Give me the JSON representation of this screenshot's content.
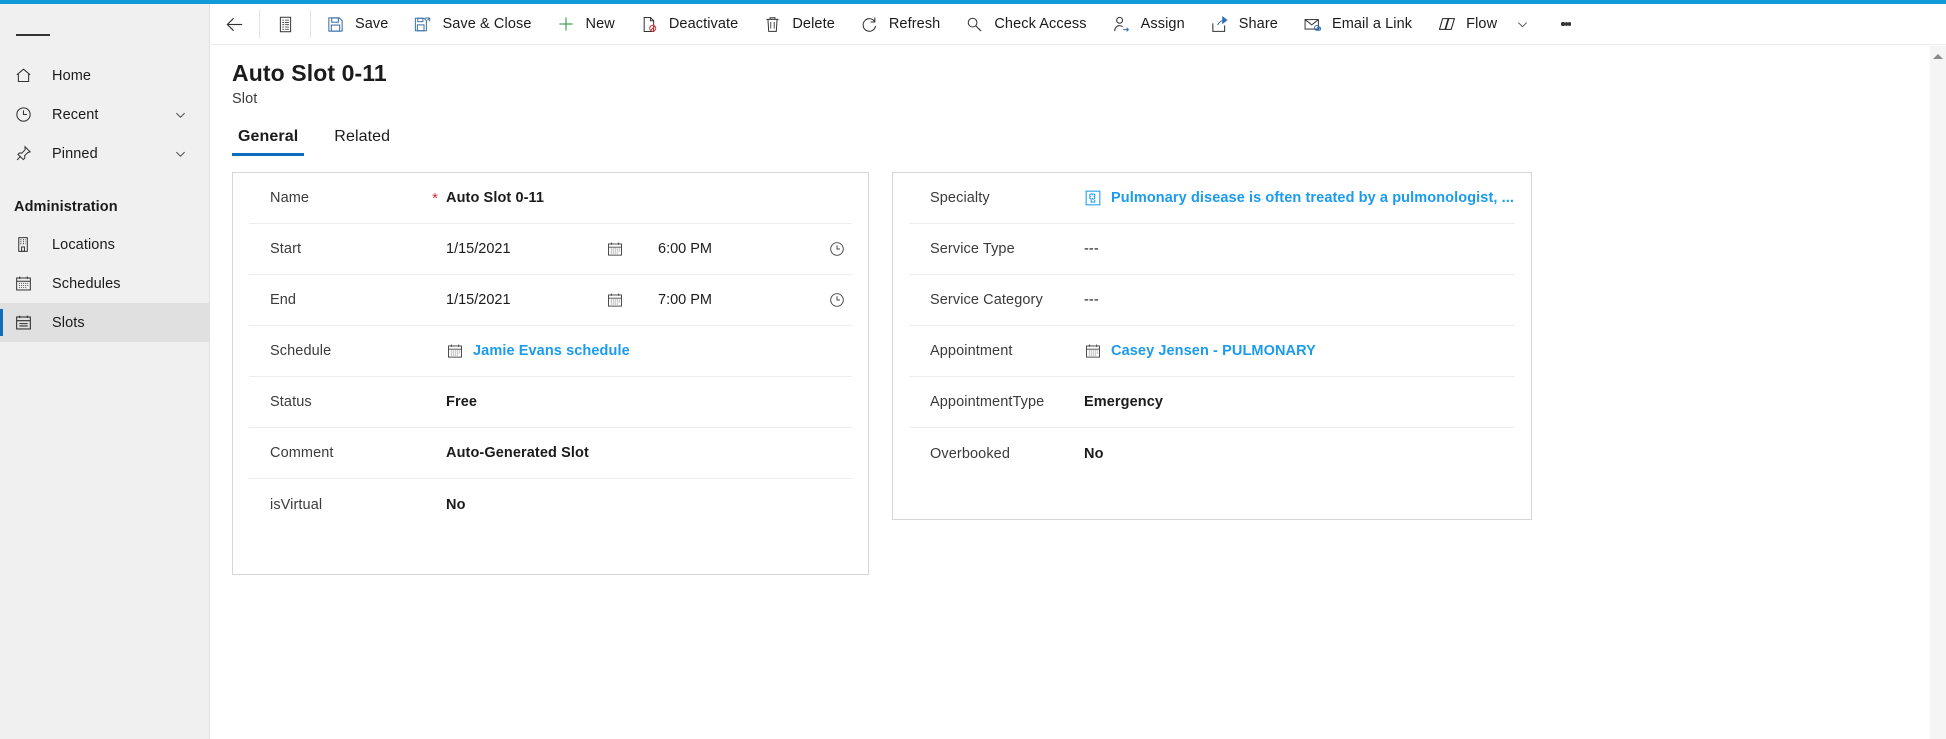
{
  "theme": {
    "accent_bar": "#0f9bd7",
    "link_blue": "#1a9bed",
    "tab_underline": "#0f6cbd",
    "required_red": "#d13438",
    "sidebar_bg": "#f0f0f0"
  },
  "sidebar": {
    "menu_icon": "hamburger-icon",
    "items": [
      {
        "label": "Home",
        "icon": "home-icon",
        "chevron": false,
        "selected": false
      },
      {
        "label": "Recent",
        "icon": "clock-icon",
        "chevron": true,
        "selected": false
      },
      {
        "label": "Pinned",
        "icon": "pin-icon",
        "chevron": true,
        "selected": false
      }
    ],
    "group_title": "Administration",
    "group_items": [
      {
        "label": "Locations",
        "icon": "building-icon",
        "selected": false
      },
      {
        "label": "Schedules",
        "icon": "calendar-icon",
        "selected": false
      },
      {
        "label": "Slots",
        "icon": "slot-icon",
        "selected": true
      }
    ]
  },
  "commandbar": {
    "back_icon": "back-arrow-icon",
    "form_selector_icon": "form-list-icon",
    "buttons": [
      {
        "label": "Save",
        "icon": "save-icon"
      },
      {
        "label": "Save & Close",
        "icon": "save-close-icon"
      },
      {
        "label": "New",
        "icon": "plus-icon"
      },
      {
        "label": "Deactivate",
        "icon": "deactivate-icon"
      },
      {
        "label": "Delete",
        "icon": "trash-icon"
      },
      {
        "label": "Refresh",
        "icon": "refresh-icon"
      },
      {
        "label": "Check Access",
        "icon": "key-icon"
      },
      {
        "label": "Assign",
        "icon": "person-assign-icon"
      },
      {
        "label": "Share",
        "icon": "share-icon"
      },
      {
        "label": "Email a Link",
        "icon": "email-link-icon"
      },
      {
        "label": "Flow",
        "icon": "flow-icon",
        "has_chevron": true
      }
    ],
    "overflow_icon": "more-vertical-icon"
  },
  "header": {
    "title": "Auto Slot 0-11",
    "subtitle": "Slot"
  },
  "tabs": [
    {
      "label": "General",
      "active": true
    },
    {
      "label": "Related",
      "active": false
    }
  ],
  "form": {
    "left_panel": [
      {
        "label": "Name",
        "required": true,
        "value": "Auto Slot 0-11",
        "kind": "text-bold"
      },
      {
        "label": "Start",
        "required": false,
        "date": "1/15/2021",
        "time": "6:00 PM",
        "kind": "datetime"
      },
      {
        "label": "End",
        "required": false,
        "date": "1/15/2021",
        "time": "7:00 PM",
        "kind": "datetime"
      },
      {
        "label": "Schedule",
        "required": false,
        "value": "Jamie Evans schedule",
        "kind": "lookup",
        "icon": "calendar-icon"
      },
      {
        "label": "Status",
        "required": false,
        "value": "Free",
        "kind": "text-bold"
      },
      {
        "label": "Comment",
        "required": false,
        "value": "Auto-Generated Slot",
        "kind": "text-bold"
      },
      {
        "label": "isVirtual",
        "required": false,
        "value": "No",
        "kind": "text-bold"
      }
    ],
    "right_panel": [
      {
        "label": "Specialty",
        "value": "Pulmonary disease is often treated by a pulmonologist, ...",
        "kind": "lookup",
        "icon": "puzzle-icon"
      },
      {
        "label": "Service Type",
        "value": "---",
        "kind": "text-plain"
      },
      {
        "label": "Service Category",
        "value": "---",
        "kind": "text-plain"
      },
      {
        "label": "Appointment",
        "value": "Casey Jensen - PULMONARY",
        "kind": "lookup",
        "icon": "calendar-icon"
      },
      {
        "label": "AppointmentType",
        "value": "Emergency",
        "kind": "text-bold"
      },
      {
        "label": "Overbooked",
        "value": "No",
        "kind": "text-bold"
      }
    ]
  },
  "scrollbar": {
    "name": "vertical-scrollbar",
    "arrow": "scroll-up-arrow"
  }
}
